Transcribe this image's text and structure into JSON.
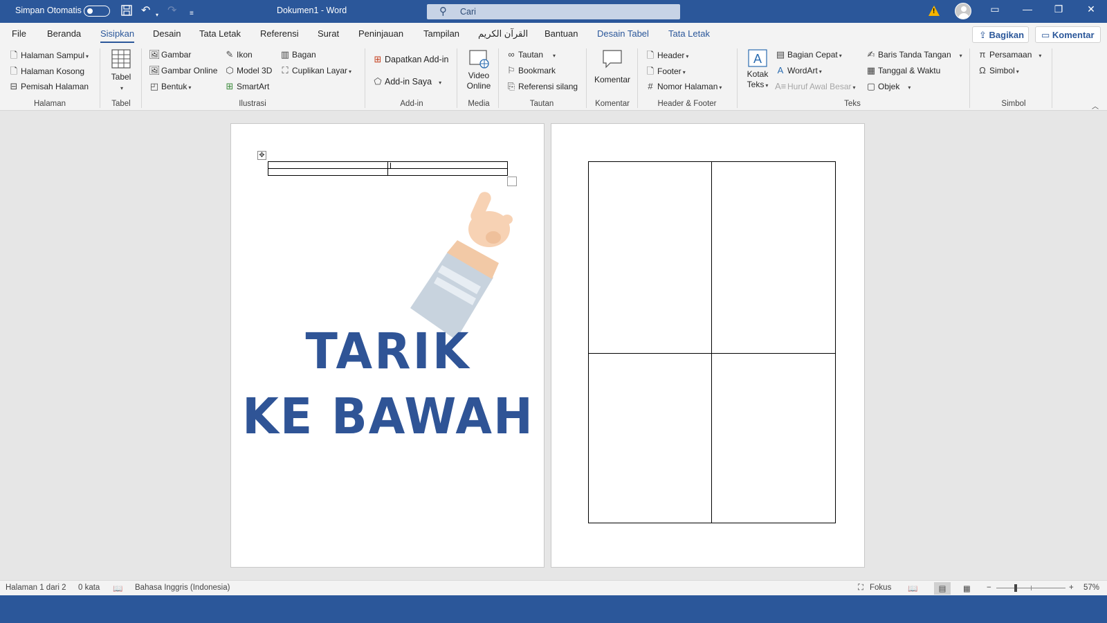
{
  "titlebar": {
    "autosave_label": "Simpan Otomatis",
    "doc_title": "Dokumen1  -  Word",
    "search_placeholder": "Cari"
  },
  "tabs": [
    "File",
    "Beranda",
    "Sisipkan",
    "Desain",
    "Tata Letak",
    "Referensi",
    "Surat",
    "Peninjauan",
    "Tampilan",
    "القرآن الكريم",
    "Bantuan",
    "Desain Tabel",
    "Tata Letak"
  ],
  "active_tab": "Sisipkan",
  "share_label": "Bagikan",
  "comment_label": "Komentar",
  "ribbon": {
    "halaman": {
      "items": [
        "Halaman Sampul",
        "Halaman Kosong",
        "Pemisah Halaman"
      ],
      "group": "Halaman"
    },
    "tabel": {
      "label": "Tabel",
      "group": "Tabel"
    },
    "ilustrasi": {
      "items": [
        "Gambar",
        "Gambar Online",
        "Bentuk",
        "Ikon",
        "Model 3D",
        "SmartArt",
        "Bagan",
        "Cuplikan Layar"
      ],
      "group": "Ilustrasi"
    },
    "addin": {
      "items": [
        "Dapatkan Add-in",
        "Add-in Saya"
      ],
      "group": "Add-in"
    },
    "media": {
      "label_1": "Video",
      "label_2": "Online",
      "group": "Media"
    },
    "tautan": {
      "items": [
        "Tautan",
        "Bookmark",
        "Referensi silang"
      ],
      "group": "Tautan"
    },
    "komentar": {
      "label": "Komentar",
      "group": "Komentar"
    },
    "headerfooter": {
      "items": [
        "Header",
        "Footer",
        "Nomor Halaman"
      ],
      "group": "Header & Footer"
    },
    "teks": {
      "kotak_1": "Kotak",
      "kotak_2": "Teks",
      "items": [
        "Bagian Cepat",
        "WordArt",
        "Huruf Awal Besar",
        "Baris Tanda Tangan",
        "Tanggal & Waktu",
        "Objek"
      ],
      "group": "Teks"
    },
    "simbol": {
      "items": [
        "Persamaan",
        "Simbol"
      ],
      "group": "Simbol"
    }
  },
  "page1": {
    "line1": "TARIK",
    "line2": "KE BAWAH",
    "accent": "#2f5496"
  },
  "status": {
    "page": "Halaman 1 dari 2",
    "words": "0 kata",
    "language": "Bahasa Inggris (Indonesia)",
    "focus": "Fokus",
    "zoom": "57%"
  },
  "colors": {
    "brand": "#2b579a",
    "ribbon_bg": "#f3f3f3",
    "canvas_bg": "#e6e6e6"
  }
}
